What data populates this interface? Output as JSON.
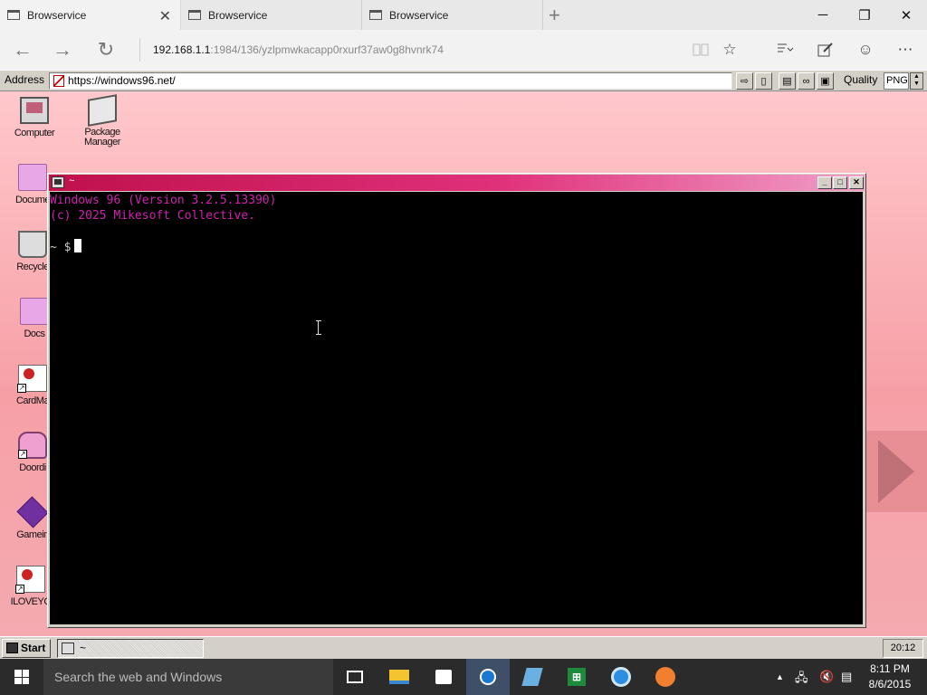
{
  "browser": {
    "tabs": [
      {
        "label": "Browservice",
        "active": true
      },
      {
        "label": "Browservice",
        "active": false
      },
      {
        "label": "Browservice",
        "active": false
      }
    ],
    "new_tab_glyph": "+",
    "window_controls": {
      "minimize": "─",
      "restore": "❐",
      "close": "✕"
    },
    "nav": {
      "back": "←",
      "forward": "→",
      "refresh": "↻"
    },
    "url_host": "192.168.1.1",
    "url_rest": ":1984/136/yzlpmwkacapp0rxurf37aw0g8hvnrk74"
  },
  "toolbar": {
    "address_label": "Address",
    "address_value": "https://windows96.net/",
    "quality_label": "Quality",
    "quality_value": "PNG"
  },
  "desktop": {
    "icons": [
      {
        "label": "Computer",
        "icon": "computer-icon"
      },
      {
        "label": "Package Manager",
        "icon": "package-icon"
      },
      {
        "label": "Docume",
        "icon": "folder-icon"
      },
      {
        "label": "Recycle",
        "icon": "trash-icon"
      },
      {
        "label": "Docs",
        "icon": "folder-icon"
      },
      {
        "label": "CardMa",
        "icon": "shortcut-icon"
      },
      {
        "label": "Doordi",
        "icon": "doordi-icon"
      },
      {
        "label": "Gamein",
        "icon": "game-icon"
      },
      {
        "label": "ILOVEYO",
        "icon": "shortcut-icon"
      }
    ]
  },
  "terminal": {
    "title": "~",
    "lines": [
      "Windows 96 (Version 3.2.5.13390)",
      "(c) 2025 Mikesoft Collective."
    ],
    "prompt": "~ $",
    "text_color": "#d020b0"
  },
  "win96_taskbar": {
    "start_label": "Start",
    "task_label": "~",
    "clock": "20:12"
  },
  "win10_taskbar": {
    "search_placeholder": "Search the web and Windows",
    "time": "8:11 PM",
    "date": "8/6/2015",
    "tray_up": "▲"
  },
  "colors": {
    "titlebar_accent": "#c0104c",
    "desktop_bg": "#f6a0a6"
  }
}
